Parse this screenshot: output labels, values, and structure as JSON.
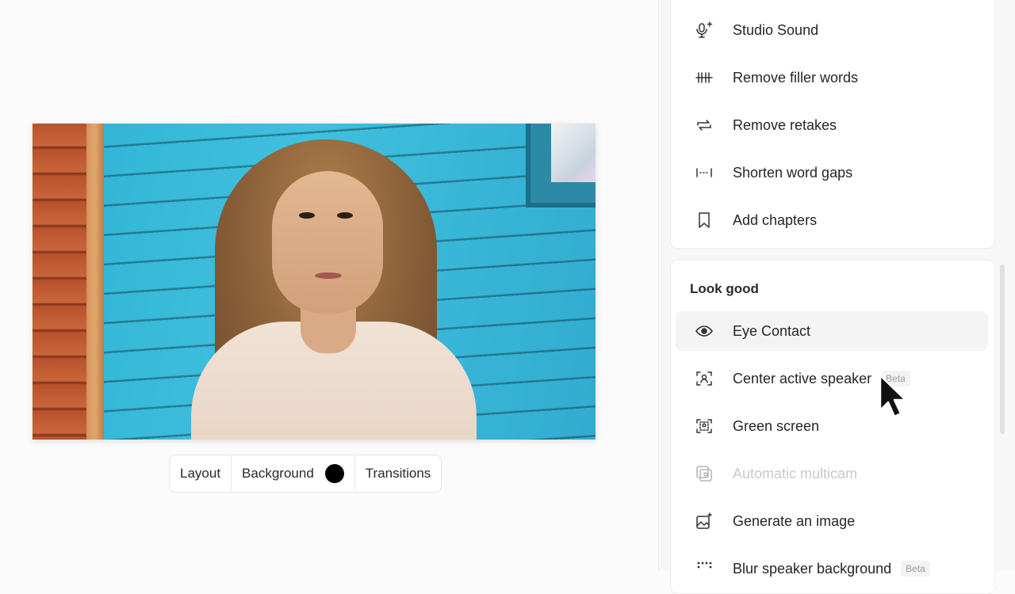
{
  "toolbar": {
    "layout_label": "Layout",
    "background_label": "Background",
    "background_color": "#000000",
    "transitions_label": "Transitions"
  },
  "sound_section": {
    "items": [
      {
        "label": "Studio Sound",
        "icon": "mic-sparkle-icon"
      },
      {
        "label": "Remove filler words",
        "icon": "filler-words-icon"
      },
      {
        "label": "Remove retakes",
        "icon": "retake-arrows-icon"
      },
      {
        "label": "Shorten word gaps",
        "icon": "word-gaps-icon"
      },
      {
        "label": "Add chapters",
        "icon": "bookmark-icon"
      }
    ]
  },
  "look_section": {
    "title": "Look good",
    "items": [
      {
        "label": "Eye Contact",
        "icon": "eye-icon"
      },
      {
        "label": "Center active speaker",
        "icon": "center-speaker-icon",
        "badge": "Beta"
      },
      {
        "label": "Green screen",
        "icon": "green-screen-icon"
      },
      {
        "label": "Automatic multicam",
        "icon": "multicam-icon"
      },
      {
        "label": "Generate an image",
        "icon": "generate-image-icon"
      },
      {
        "label": "Blur speaker background",
        "icon": "blur-background-icon",
        "badge": "Beta"
      }
    ]
  }
}
